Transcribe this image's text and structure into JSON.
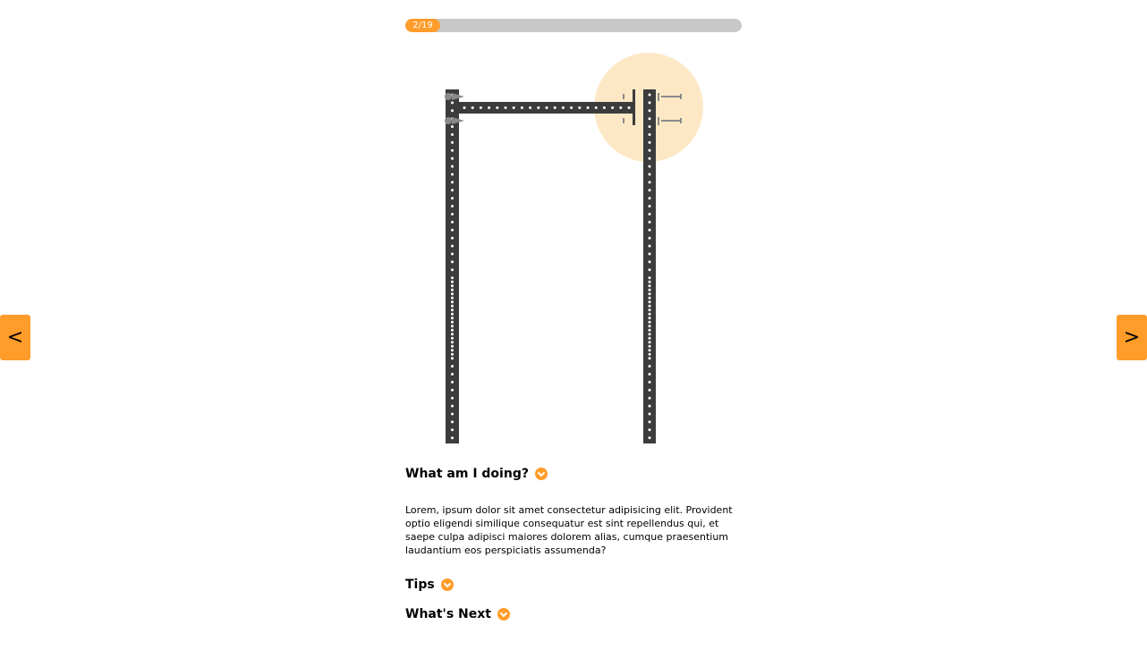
{
  "progress": {
    "label": "2/19",
    "current": 2,
    "total": 19,
    "fraction": 0.105,
    "fill_color": "#ff9c2a"
  },
  "nav": {
    "prev_label": "<",
    "next_label": ">"
  },
  "sections": [
    {
      "title": "What am I doing?",
      "expanded": true,
      "body": "Lorem, ipsum dolor sit amet consectetur adipisicing elit. Provident optio eligendi similique consequatur est sint repellendus qui, et saepe culpa adipisci maiores dolorem alias, cumque praesentium laudantium eos perspiciatis assumenda?"
    },
    {
      "title": "Tips",
      "expanded": false
    },
    {
      "title": "What's Next",
      "expanded": false
    }
  ],
  "colors": {
    "accent": "#ff9c2a",
    "upright": "#3c3c3c",
    "highlight": "#fde8c6"
  },
  "icons": {
    "section_toggle": "chevron-down-icon"
  }
}
